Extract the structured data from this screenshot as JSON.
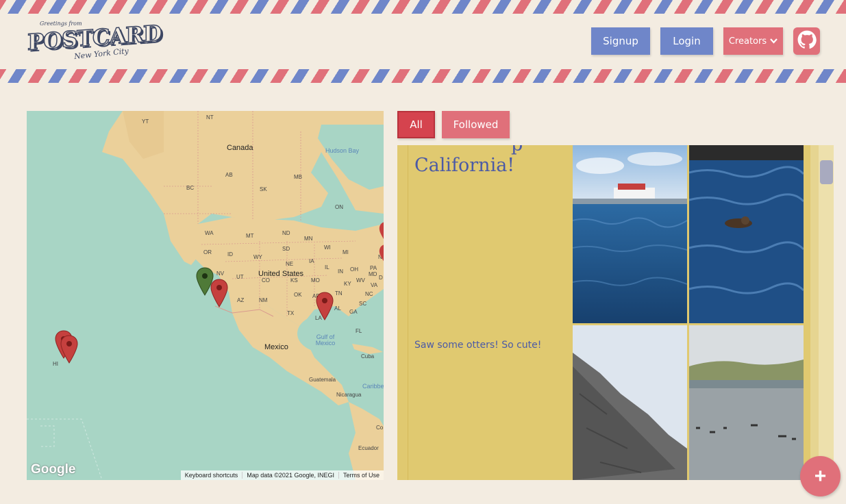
{
  "header": {
    "logo": {
      "greeting": "Greetings from",
      "name": "POSTCARD",
      "city": "New York City"
    },
    "signup_label": "Signup",
    "login_label": "Login",
    "creators_label": "Creators",
    "creators_icon": "chevron-down-icon",
    "github_icon": "github-icon",
    "colors": {
      "blue": "#6f86c9",
      "red": "#e0707a",
      "background": "#f3ece1"
    }
  },
  "map": {
    "labels": {
      "canada": "Canada",
      "united_states": "United States",
      "mexico": "Mexico",
      "cuba": "Cuba",
      "guatemala": "Guatemala",
      "nicaragua": "Nicaragua",
      "ecuador": "Ecuador",
      "hudson_bay": "Hudson Bay",
      "gulf": "Gulf of Mexico",
      "caribbean": "Caribbe",
      "co": "Co",
      "yt": "YT",
      "nt": "NT",
      "bc": "BC",
      "ab": "AB",
      "sk": "SK",
      "mb": "MB",
      "on": "ON",
      "wa": "WA",
      "or": "OR",
      "id": "ID",
      "mt": "MT",
      "wy": "WY",
      "nd": "ND",
      "sd": "SD",
      "ne": "NE",
      "mn": "MN",
      "ia": "IA",
      "wi": "WI",
      "mi": "MI",
      "il": "IL",
      "in": "IN",
      "oh": "OH",
      "pa": "PA",
      "nv": "NV",
      "ut": "UT",
      "co_state": "CO",
      "ks": "KS",
      "mo": "MO",
      "ky": "KY",
      "wv": "WV",
      "va": "VA",
      "md": "MD",
      "az": "AZ",
      "nm": "NM",
      "ok": "OK",
      "ar": "AR",
      "tn": "TN",
      "nc": "NC",
      "sc": "SC",
      "tx": "TX",
      "la": "LA",
      "al": "AL",
      "ga": "GA",
      "fl": "FL",
      "hi": "HI",
      "ny": "N",
      "de": "D"
    },
    "google_logo": "Google",
    "footer": {
      "shortcuts": "Keyboard shortcuts",
      "data": "Map data ©2021 Google, INEGI",
      "terms": "Terms of Use"
    },
    "marker_colors": {
      "default": "#c5403e",
      "selected": "#4f7a38"
    }
  },
  "tabs": {
    "all_label": "All",
    "followed_label": "Followed"
  },
  "feed": {
    "title": "California!",
    "title_partial": "p",
    "caption": "Saw some otters! So cute!"
  },
  "fab": {
    "label": "+",
    "icon": "plus-icon"
  }
}
